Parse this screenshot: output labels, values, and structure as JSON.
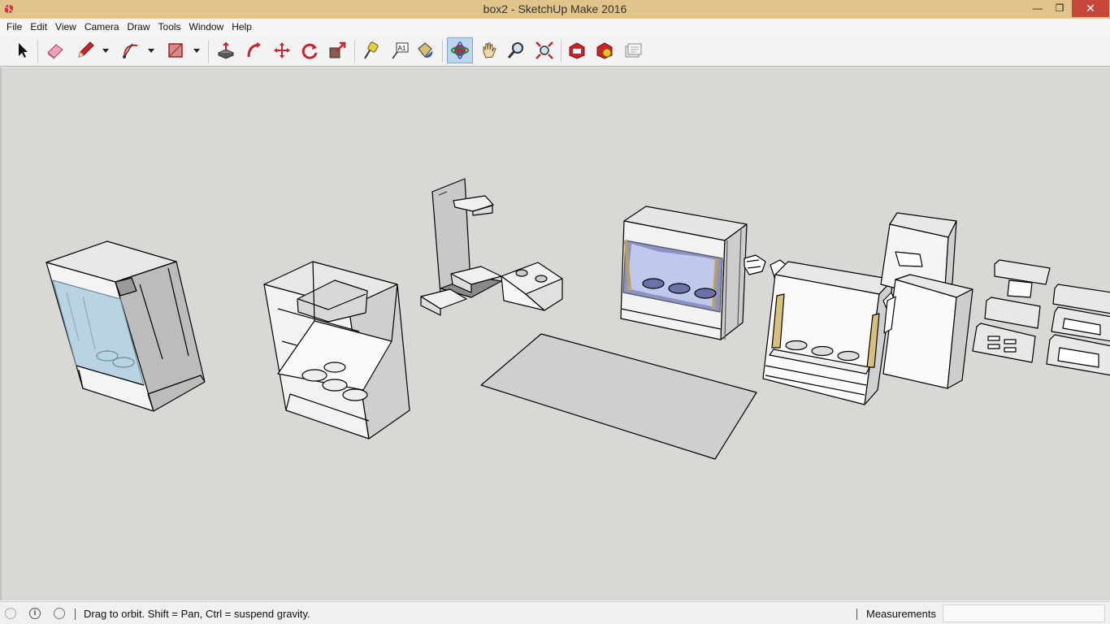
{
  "window": {
    "title": "box2 - SketchUp Make 2016",
    "minimize_glyph": "—",
    "maximize_glyph": "❐",
    "close_glyph": "✕"
  },
  "menu": {
    "items": [
      {
        "label": "File"
      },
      {
        "label": "Edit"
      },
      {
        "label": "View"
      },
      {
        "label": "Camera"
      },
      {
        "label": "Draw"
      },
      {
        "label": "Tools"
      },
      {
        "label": "Window"
      },
      {
        "label": "Help"
      }
    ]
  },
  "toolbar": {
    "tools": [
      {
        "name": "select-tool",
        "icon": "arrow-cursor-icon"
      },
      {
        "name": "eraser-tool",
        "icon": "eraser-icon"
      },
      {
        "name": "line-tool",
        "icon": "pencil-icon"
      },
      {
        "name": "arc-tool",
        "icon": "arc-icon"
      },
      {
        "name": "rectangle-tool",
        "icon": "rectangle-icon"
      },
      {
        "name": "push-pull-tool",
        "icon": "push-pull-icon"
      },
      {
        "name": "follow-me-tool",
        "icon": "follow-me-icon"
      },
      {
        "name": "move-tool",
        "icon": "move-icon"
      },
      {
        "name": "rotate-tool",
        "icon": "rotate-icon"
      },
      {
        "name": "scale-tool",
        "icon": "scale-icon"
      },
      {
        "name": "tape-measure-tool",
        "icon": "tape-measure-icon"
      },
      {
        "name": "text-tool",
        "icon": "text-label-icon"
      },
      {
        "name": "paint-bucket-tool",
        "icon": "paint-bucket-icon"
      },
      {
        "name": "orbit-tool",
        "icon": "orbit-icon",
        "active": true
      },
      {
        "name": "pan-tool",
        "icon": "hand-icon"
      },
      {
        "name": "zoom-tool",
        "icon": "magnifier-icon"
      },
      {
        "name": "zoom-extents-tool",
        "icon": "zoom-extents-icon"
      },
      {
        "name": "3d-warehouse-tool",
        "icon": "warehouse-icon"
      },
      {
        "name": "extension-warehouse-tool",
        "icon": "extension-icon"
      },
      {
        "name": "layout-tool",
        "icon": "layout-icon"
      }
    ],
    "text_tool_glyph": "A1"
  },
  "status": {
    "hint": "Drag to orbit. Shift = Pan, Ctrl = suspend gravity.",
    "measurements_label": "Measurements",
    "measurements_value": "",
    "info_glyph": "i"
  },
  "colors": {
    "titlebar": "#e1c48a",
    "close_button": "#c7463a",
    "viewport_background": "#d9d8d5",
    "active_tool": "#bcd6ee",
    "glass_blue": "#b8d4e2",
    "glass_purple": "#8a93c8",
    "accent_wood": "#d8c07a"
  }
}
